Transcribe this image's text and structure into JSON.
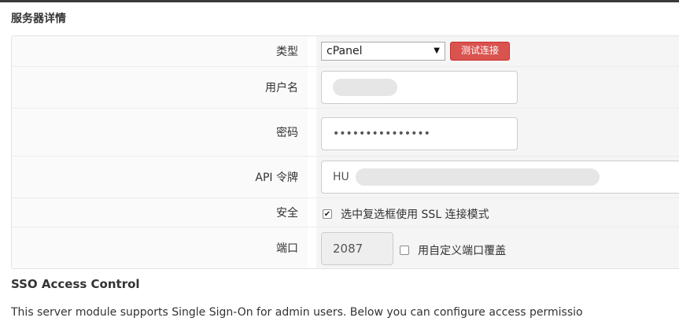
{
  "header": {
    "title": "服务器详情"
  },
  "form": {
    "type": {
      "label": "类型",
      "value": "cPanel",
      "test_button": "测试连接"
    },
    "username": {
      "label": "用户名",
      "value": ""
    },
    "password": {
      "label": "密码",
      "value": "•••••••••••••••"
    },
    "api_token": {
      "label": "API 令牌",
      "value_prefix": "HU"
    },
    "security": {
      "label": "安全",
      "checkbox_label": "选中复选框使用 SSL 连接模式",
      "checked": true
    },
    "port": {
      "label": "端口",
      "value": "2087",
      "checkbox_label": "用自定义端口覆盖",
      "checked": false
    }
  },
  "sso": {
    "title": "SSO Access Control",
    "description": "This server module supports Single Sign-On for admin users. Below you can configure access permissio"
  },
  "colors": {
    "danger": "#d9534f",
    "field_bg": "#f5f5f5",
    "border": "#cccccc"
  },
  "icons": {
    "select_arrow": "caret-down-icon",
    "check": "checkmark-icon"
  }
}
